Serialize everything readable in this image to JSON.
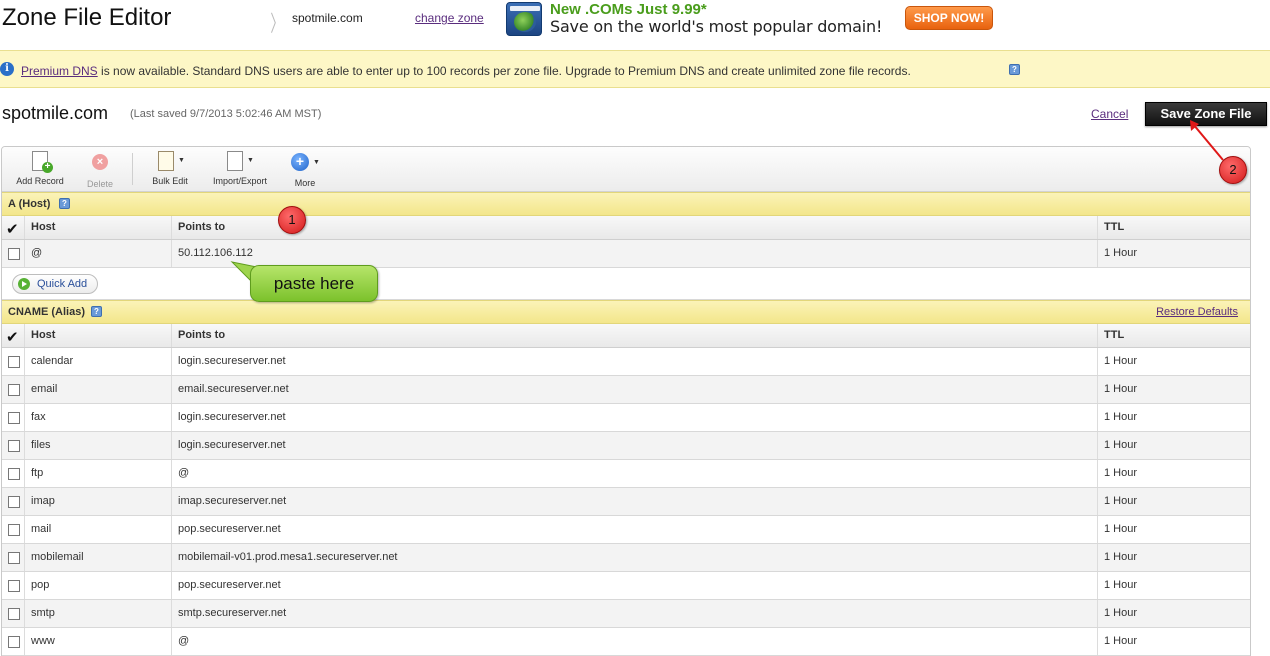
{
  "header": {
    "app_title": "Zone File Editor",
    "zone_name": "spotmile.com",
    "change_zone": "change zone",
    "promo_headline": "New .COMs Just 9.99*",
    "promo_sub": "Save on the world's most popular domain!",
    "shop_now": "SHOP NOW!"
  },
  "banner": {
    "link": "Premium DNS",
    "text": " is now available. Standard DNS users are able to enter up to 100 records per zone file. Upgrade to Premium DNS and create unlimited zone file records."
  },
  "zone": {
    "title": "spotmile.com",
    "last_saved": "(Last saved 9/7/2013 5:02:46 AM MST)",
    "cancel": "Cancel",
    "save": "Save Zone File"
  },
  "toolbar": {
    "add_record": "Add Record",
    "delete": "Delete",
    "bulk_edit": "Bulk Edit",
    "import_export": "Import/Export",
    "more": "More"
  },
  "a_section": {
    "title": "A (Host)",
    "columns": {
      "host": "Host",
      "points_to": "Points to",
      "ttl": "TTL"
    },
    "rows": [
      {
        "host": "@",
        "points_to": "50.112.106.112",
        "ttl": "1 Hour"
      }
    ],
    "quick_add": "Quick Add"
  },
  "cname_section": {
    "title": "CNAME (Alias)",
    "restore": "Restore Defaults",
    "columns": {
      "host": "Host",
      "points_to": "Points to",
      "ttl": "TTL"
    },
    "rows": [
      {
        "host": "calendar",
        "points_to": "login.secureserver.net",
        "ttl": "1 Hour"
      },
      {
        "host": "email",
        "points_to": "email.secureserver.net",
        "ttl": "1 Hour"
      },
      {
        "host": "fax",
        "points_to": "login.secureserver.net",
        "ttl": "1 Hour"
      },
      {
        "host": "files",
        "points_to": "login.secureserver.net",
        "ttl": "1 Hour"
      },
      {
        "host": "ftp",
        "points_to": "@",
        "ttl": "1 Hour"
      },
      {
        "host": "imap",
        "points_to": "imap.secureserver.net",
        "ttl": "1 Hour"
      },
      {
        "host": "mail",
        "points_to": "pop.secureserver.net",
        "ttl": "1 Hour"
      },
      {
        "host": "mobilemail",
        "points_to": "mobilemail-v01.prod.mesa1.secureserver.net",
        "ttl": "1 Hour"
      },
      {
        "host": "pop",
        "points_to": "pop.secureserver.net",
        "ttl": "1 Hour"
      },
      {
        "host": "smtp",
        "points_to": "smtp.secureserver.net",
        "ttl": "1 Hour"
      },
      {
        "host": "www",
        "points_to": "@",
        "ttl": "1 Hour"
      }
    ]
  },
  "annotations": {
    "badge_1": "1",
    "badge_2": "2",
    "callout": "paste here"
  },
  "colors": {
    "accent_green": "#4a9d1c",
    "shop_orange": "#e8620e",
    "banner_yellow": "#fdf7c6",
    "annotation_red": "#d21a1a",
    "link_purple": "#5a2d7e"
  }
}
